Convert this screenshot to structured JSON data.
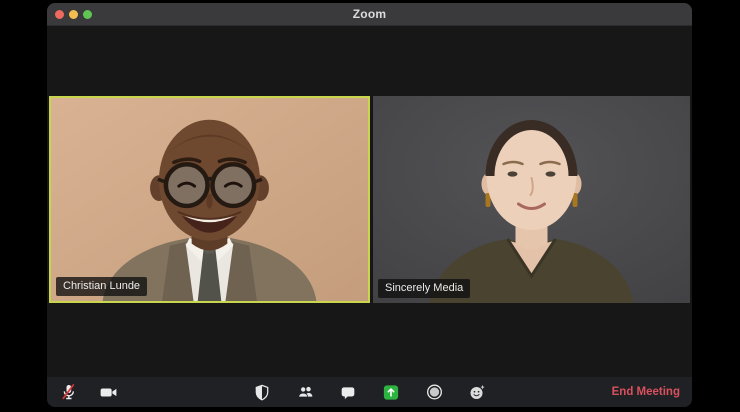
{
  "window": {
    "title": "Zoom",
    "traffic_lights": [
      {
        "id": "close",
        "color": "#ee6a5f"
      },
      {
        "id": "minimize",
        "color": "#f5bd4f"
      },
      {
        "id": "maximize",
        "color": "#61c554"
      }
    ]
  },
  "participants": [
    {
      "name": "Christian Lunde",
      "active_speaker": true,
      "video_on": true
    },
    {
      "name": "Sincerely Media",
      "active_speaker": false,
      "video_on": true
    }
  ],
  "toolbar": {
    "buttons": [
      {
        "id": "mute",
        "icon": "microphone-muted-icon",
        "state": "muted"
      },
      {
        "id": "video",
        "icon": "video-camera-icon",
        "state": "on"
      },
      {
        "id": "security",
        "icon": "security-shield-icon"
      },
      {
        "id": "participants",
        "icon": "participants-icon"
      },
      {
        "id": "chat",
        "icon": "chat-bubble-icon"
      },
      {
        "id": "share-screen",
        "icon": "share-screen-icon"
      },
      {
        "id": "record",
        "icon": "record-icon"
      },
      {
        "id": "reactions",
        "icon": "reactions-smiley-icon"
      }
    ],
    "end_meeting_label": "End Meeting"
  },
  "colors": {
    "active_speaker_border": "#c7d64c",
    "share_screen_green": "#2db340",
    "end_meeting_red": "#d9505e",
    "mute_slash_red": "#d93636",
    "titlebar_bg": "#3a3a3c",
    "content_bg": "#171717",
    "toolbar_bg": "#1f2124"
  }
}
